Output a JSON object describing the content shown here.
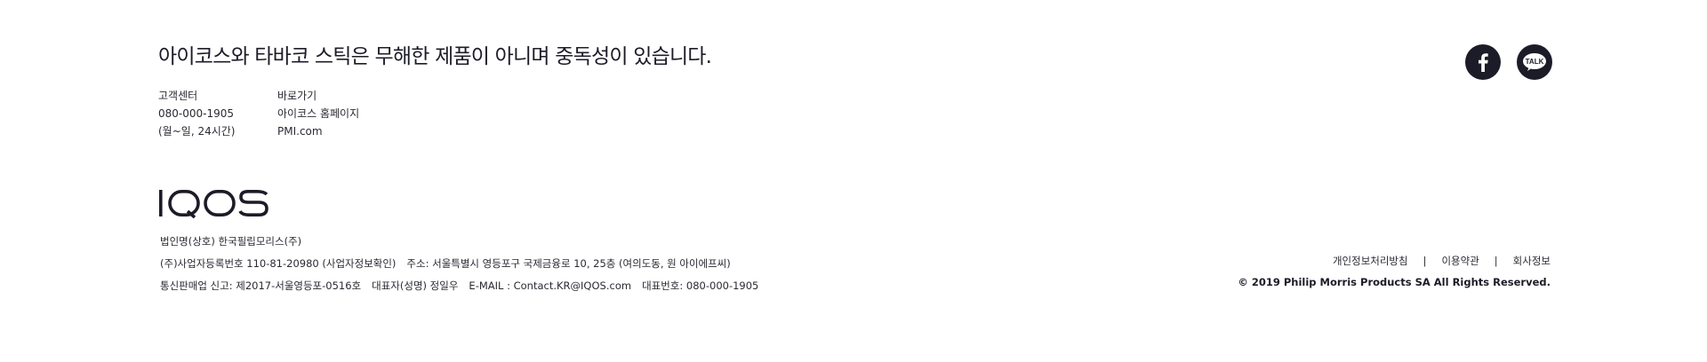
{
  "warning": "아이코스와 타바코 스틱은 무해한 제품이 아니며 중독성이 있습니다.",
  "customer_center": {
    "title": "고객센터",
    "phone": "080-000-1905",
    "hours": "(월~일, 24시간)"
  },
  "shortcuts": {
    "title": "바로가기",
    "items": [
      "아이코스 홈페이지",
      "PMI.com"
    ]
  },
  "social": {
    "facebook_icon": "facebook-icon",
    "kakaotalk_icon": "kakaotalk-icon",
    "kakaotalk_text": "TALK"
  },
  "logo_text": "IQOS",
  "corp": {
    "company_name": "법인명(상호) 한국필립모리스(주)",
    "business_reg": "(주)사업자등록번호 110-81-20980 (사업자정보확인)",
    "address": "주소: 서울특별시 영등포구 국제금융로 10, 25층 (여의도동, 원 아이에프씨)",
    "mail_order": "통신판매업 신고: 제2017-서울영등포-0516호",
    "ceo": "대표자(성명) 정일우",
    "email": "E-MAIL : Contact.KR@IQOS.com",
    "main_phone": "대표번호: 080-000-1905"
  },
  "legal_links": [
    "개인정보처리방침",
    "이용약관",
    "회사정보"
  ],
  "link_separator": "|",
  "copyright": "© 2019 Philip Morris Products SA All Rights Reserved.",
  "colors": {
    "text": "#1c1c28",
    "background": "#ffffff",
    "icon_bg": "#1c1c28"
  }
}
